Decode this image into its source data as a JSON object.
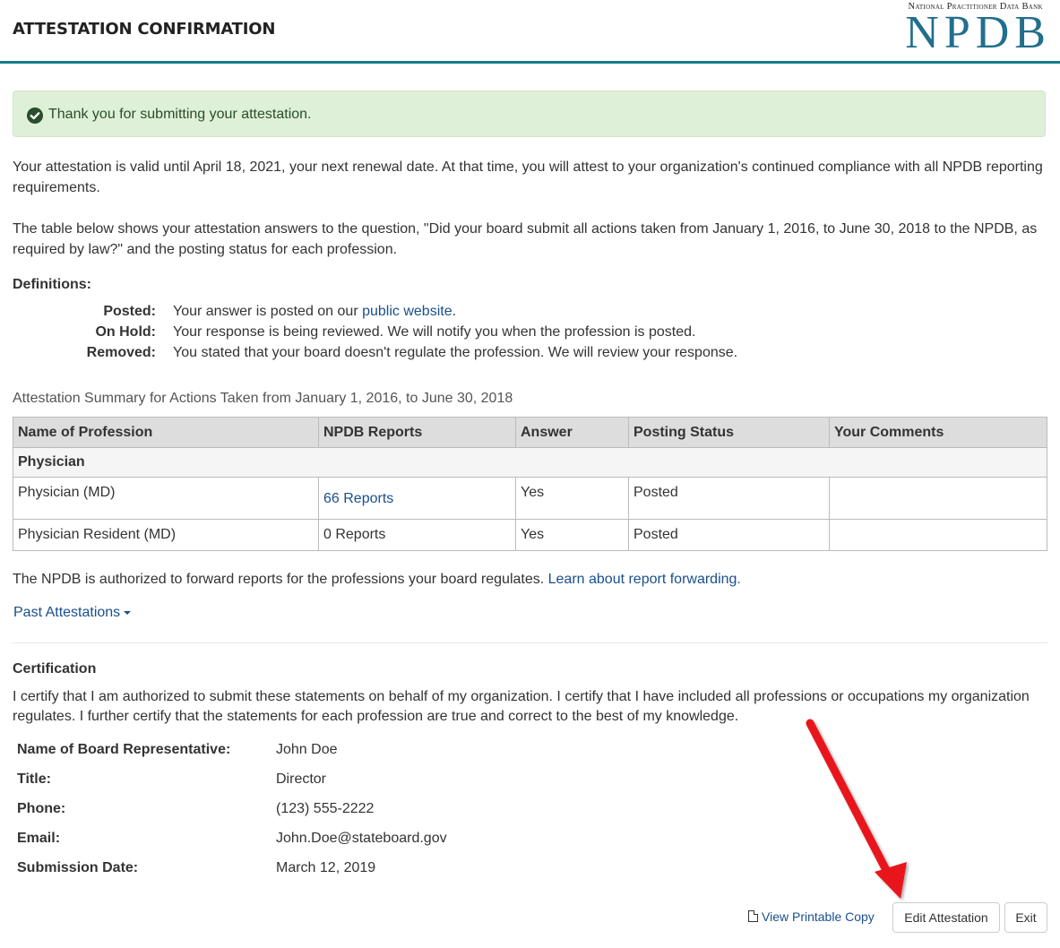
{
  "header": {
    "title": "ATTESTATION CONFIRMATION",
    "logo_subtitle": "National Practitioner Data Bank",
    "logo_text": "NPDB"
  },
  "alert": {
    "icon": "check-circle-icon",
    "message": "Thank you for submitting your attestation."
  },
  "intro": {
    "validity": "Your attestation is valid until April 18, 2021, your next renewal date. At that time, you will attest to your organization's continued compliance with all NPDB reporting requirements.",
    "table_explanation": "The table below shows your attestation answers to the question, \"Did your board submit all actions taken from January 1, 2016, to June 30, 2018 to the NPDB, as required by law?\" and the posting status for each profession."
  },
  "definitions": {
    "title": "Definitions:",
    "items": [
      {
        "term": "Posted:",
        "desc_before": "Your answer is posted on our ",
        "link": "public website",
        "desc_after": "."
      },
      {
        "term": "On Hold:",
        "desc_before": "Your response is being reviewed. We will notify you when the profession is posted.",
        "link": "",
        "desc_after": ""
      },
      {
        "term": "Removed:",
        "desc_before": "You stated that your board doesn't regulate the profession. We will review your response.",
        "link": "",
        "desc_after": ""
      }
    ]
  },
  "summary": {
    "caption": "Attestation Summary for Actions Taken from January 1, 2016, to June 30, 2018",
    "columns": [
      "Name of Profession",
      "NPDB Reports",
      "Answer",
      "Posting Status",
      "Your Comments"
    ],
    "group": "Physician",
    "rows": [
      {
        "profession": "Physician (MD)",
        "reports": "66 Reports",
        "reports_is_link": true,
        "answer": "Yes",
        "status": "Posted",
        "comments": ""
      },
      {
        "profession": "Physician Resident (MD)",
        "reports": "0 Reports",
        "reports_is_link": false,
        "answer": "Yes",
        "status": "Posted",
        "comments": ""
      }
    ]
  },
  "forwarding": {
    "text": "The NPDB is authorized to forward reports for the professions your board regulates. ",
    "link": "Learn about report forwarding."
  },
  "past_attestations": {
    "label": "Past Attestations"
  },
  "certification": {
    "title": "Certification",
    "statement": "I certify that I am authorized to submit these statements on behalf of my organization. I certify that I have included all professions or occupations my organization regulates. I further certify that the statements for each profession are true and correct to the best of my knowledge.",
    "fields": [
      {
        "label": "Name of Board Representative:",
        "value": "John Doe"
      },
      {
        "label": "Title:",
        "value": "Director"
      },
      {
        "label": "Phone:",
        "value": "(123) 555-2222"
      },
      {
        "label": "Email:",
        "value": "John.Doe@stateboard.gov"
      },
      {
        "label": "Submission Date:",
        "value": "March 12, 2019"
      }
    ]
  },
  "actions": {
    "print_link": "View Printable Copy",
    "print_icon": "pdf-file-icon",
    "edit_button": "Edit Attestation",
    "exit_button": "Exit"
  },
  "colors": {
    "brand_teal": "#137c8b",
    "logo_blue": "#216f8c",
    "link": "#1a4f8b",
    "success_bg": "#dff0d8",
    "annotation_arrow": "#e8141b"
  }
}
